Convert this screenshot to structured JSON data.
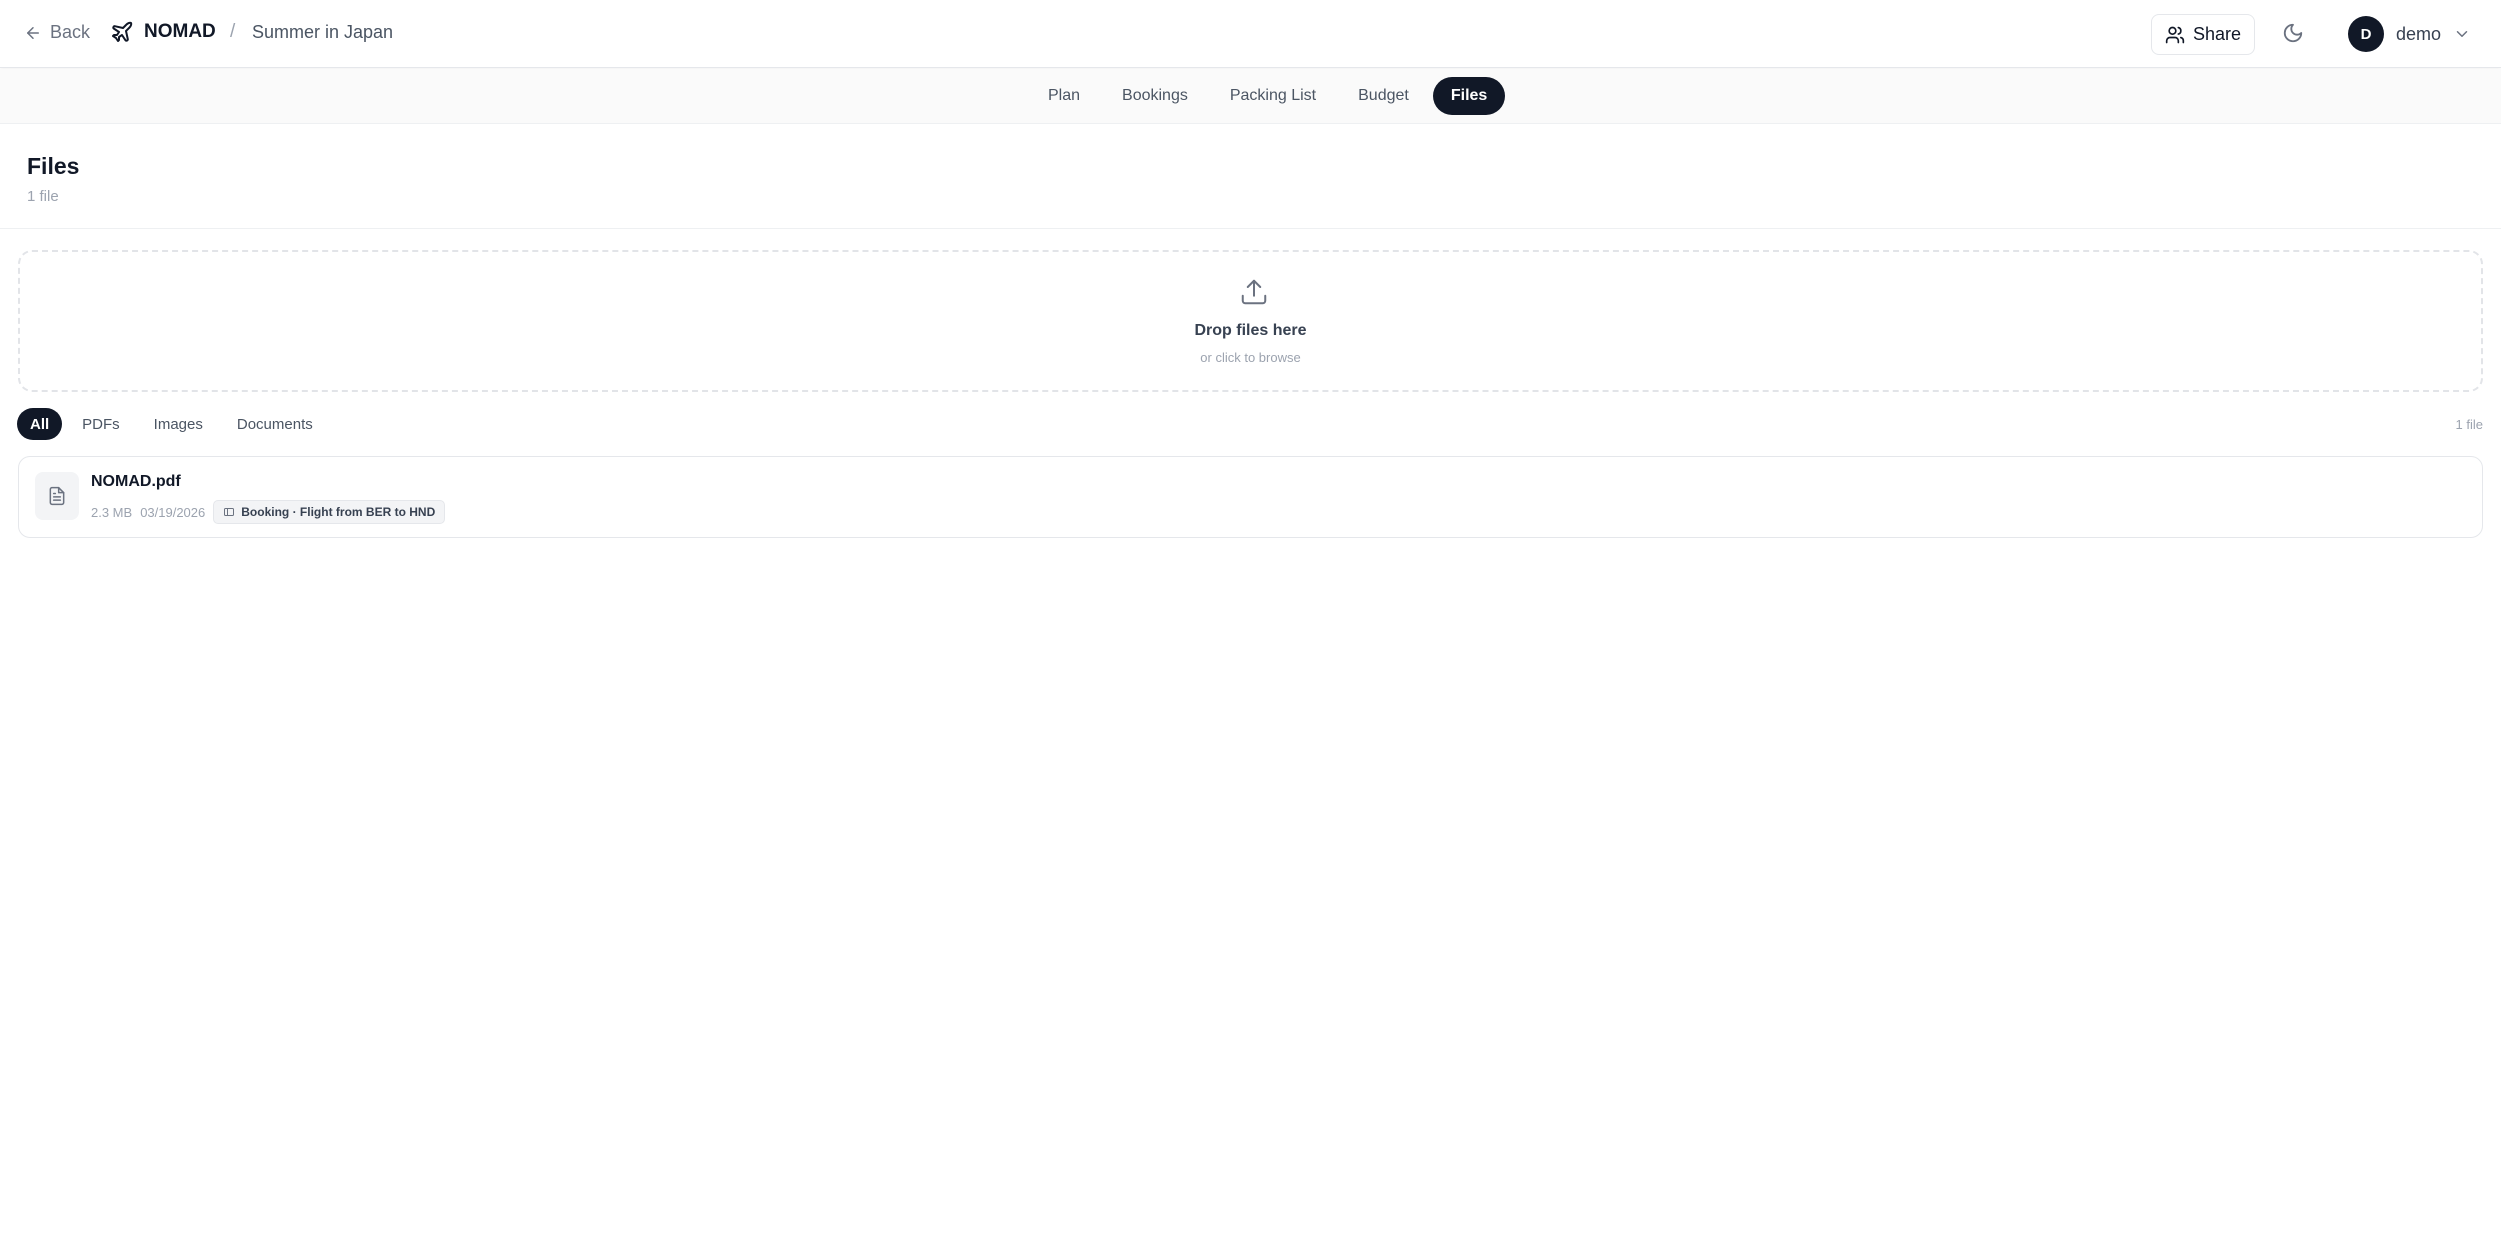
{
  "header": {
    "back_label": "Back",
    "brand": "NOMAD",
    "separator": "/",
    "trip_name": "Summer in Japan",
    "share_label": "Share",
    "user": {
      "initial": "D",
      "name": "demo"
    },
    "icons": [
      "arrow-left-icon",
      "plane-icon",
      "users-icon",
      "moon-icon",
      "chevron-down-icon"
    ]
  },
  "tabs": [
    {
      "label": "Plan",
      "active": false
    },
    {
      "label": "Bookings",
      "active": false
    },
    {
      "label": "Packing List",
      "active": false
    },
    {
      "label": "Budget",
      "active": false
    },
    {
      "label": "Files",
      "active": true
    }
  ],
  "page": {
    "title": "Files",
    "subtitle": "1 file"
  },
  "dropzone": {
    "title": "Drop files here",
    "subtitle": "or click to browse",
    "icon": "upload-icon"
  },
  "filters": {
    "items": [
      {
        "label": "All",
        "active": true
      },
      {
        "label": "PDFs",
        "active": false
      },
      {
        "label": "Images",
        "active": false
      },
      {
        "label": "Documents",
        "active": false
      }
    ],
    "count": "1 file"
  },
  "files": [
    {
      "name": "NOMAD.pdf",
      "size": "2.3 MB",
      "date": "03/19/2026",
      "tag": "Booking · Flight from BER to HND",
      "icon": "file-text-icon"
    }
  ],
  "colors": {
    "primary": "#111827",
    "muted": "#9ca3af",
    "border": "#e5e7eb",
    "tabbar_bg": "#fafafa"
  }
}
